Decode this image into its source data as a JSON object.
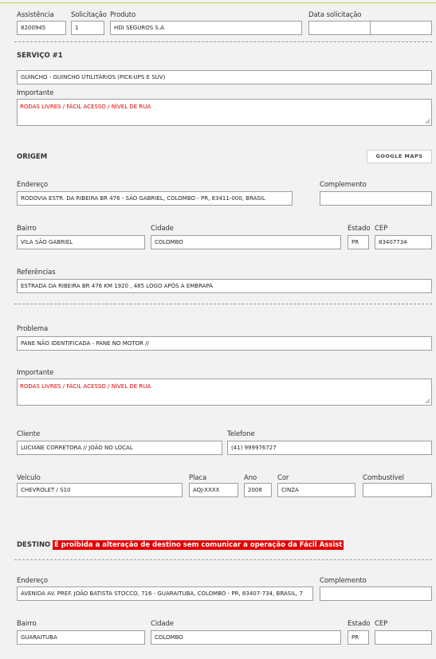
{
  "header": {
    "assistencia_label": "Assistência",
    "assistencia_value": "8200945",
    "solicitacao_label": "Solicitação",
    "solicitacao_value": "1",
    "produto_label": "Produto",
    "produto_value": "HDI SEGUROS S.A",
    "data_label": "Data solicitação",
    "data_value": "",
    "hora_value": ""
  },
  "servico": {
    "title": "SERVIÇO #1",
    "tipo_value": "GUINCHO - GUINCHO UTILITÁRIOS (PICK-UPS E SUV)",
    "importante_label": "Importante",
    "importante_value": "RODAS LIVRES / FÁCIL ACESSO / NÍVEL DE RUA"
  },
  "origem": {
    "title": "ORIGEM",
    "maps_button": "GOOGLE MAPS",
    "endereco_label": "Endereço",
    "endereco_value": "RODOVIA ESTR. DA RIBEIRA BR 476 - SÃO GABRIEL, COLOMBO - PR, 83411-000, BRASIL",
    "complemento_label": "Complemento",
    "complemento_value": "",
    "bairro_label": "Bairro",
    "bairro_value": "VILA SÃO GABRIEL",
    "cidade_label": "Cidade",
    "cidade_value": "COLOMBO",
    "estado_label": "Estado",
    "estado_value": "PR",
    "cep_label": "CEP",
    "cep_value": "83407734",
    "referencias_label": "Referências",
    "referencias_value": "ESTRADA DA RIBEIRA BR 476 KM 1920 , 485 LOGO APÓS A EMBRAPA"
  },
  "problema": {
    "problema_label": "Problema",
    "problema_value": "PANE NÃO IDENTIFICADA - PANE NO MOTOR //",
    "importante_label": "Importante",
    "importante_value": "RODAS LIVRES / FÁCIL ACESSO / NÍVEL DE RUA",
    "cliente_label": "Cliente",
    "cliente_value": "LUCIANE CORRETORA // JOÃO NO LOCAL",
    "telefone_label": "Telefone",
    "telefone_value": "(41) 999976727",
    "veiculo_label": "Veículo",
    "veiculo_value": "CHEVROLET / S10",
    "placa_label": "Placa",
    "placa_value": "AQJ-XXXX",
    "ano_label": "Ano",
    "ano_value": "2008",
    "cor_label": "Cor",
    "cor_value": "CINZA",
    "combustivel_label": "Combustível",
    "combustivel_value": ""
  },
  "destino": {
    "title": "DESTINO",
    "warning": "É proibida a alteração de destino sem comunicar a operação da Fácil Assist",
    "endereco_label": "Endereço",
    "endereco_value": "AVENIDA AV. PREF. JOÃO BATISTA STOCCO, 716 - GUARAITUBA, COLOMBO - PR, 83407-734, BRASIL, 7",
    "complemento_label": "Complemento",
    "complemento_value": "",
    "bairro_label": "Bairro",
    "bairro_value": "GUARAITUBA",
    "cidade_label": "Cidade",
    "cidade_value": "COLOMBO",
    "estado_label": "Estado",
    "estado_value": "PR",
    "cep_label": "CEP",
    "cep_value": ""
  },
  "colors": {
    "accent_line": "#c7d34a",
    "important_text": "#e00000",
    "warning_bg": "#e10000"
  }
}
